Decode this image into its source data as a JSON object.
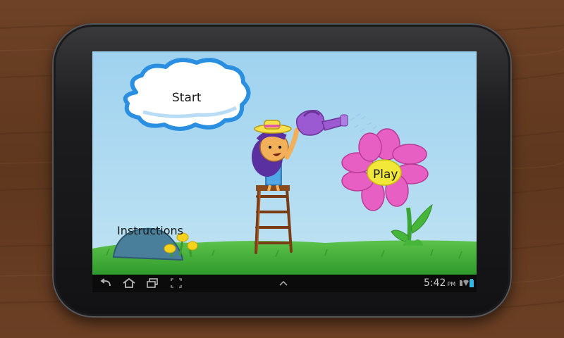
{
  "app": {
    "menu": {
      "start_label": "Start",
      "play_label": "Play",
      "instructions_label": "Instructions"
    }
  },
  "system_bar": {
    "time": "5:42",
    "time_suffix": "PM",
    "icons": [
      "back-icon",
      "home-icon",
      "recent-apps-icon",
      "screenshot-icon",
      "chevron-up-icon",
      "sd-card-icon",
      "wifi-icon",
      "battery-icon"
    ]
  },
  "colors": {
    "sky": "#8fc9ea",
    "grass": "#46b63b",
    "flower_petal": "#e85fc3",
    "flower_center": "#f1e83a",
    "watering_can": "#9b5ad1",
    "cloud_outline": "#2a8fe0",
    "nav_bar": "#0b0b0c",
    "battery_accent": "#33b5e5"
  }
}
